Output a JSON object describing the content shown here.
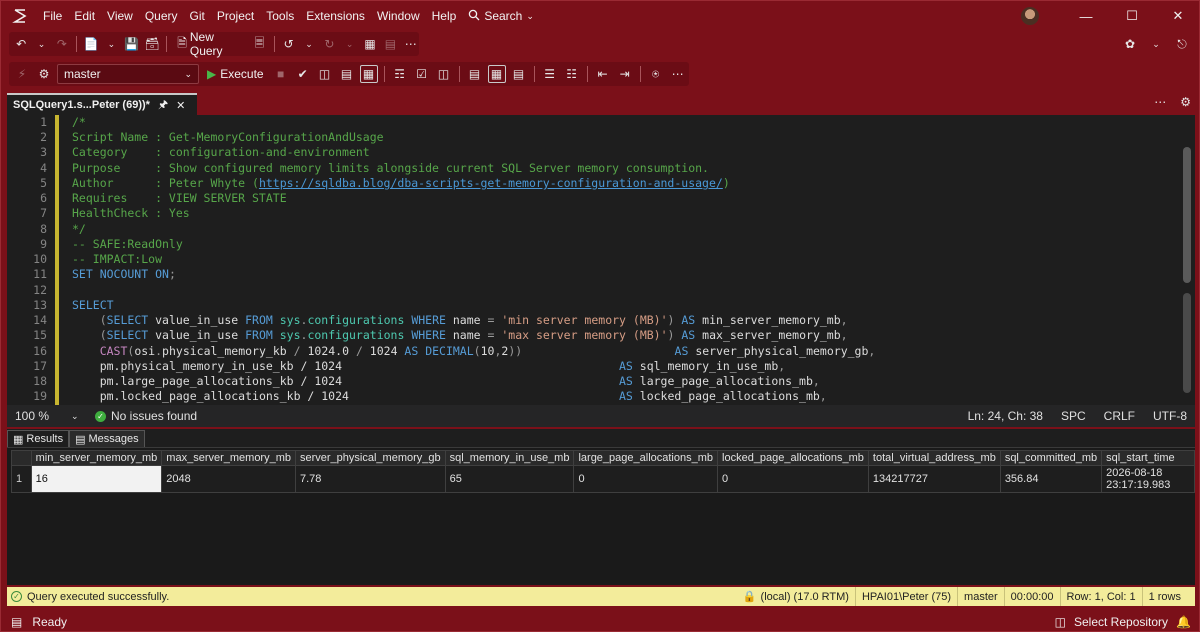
{
  "menu": [
    "File",
    "Edit",
    "View",
    "Query",
    "Git",
    "Project",
    "Tools",
    "Extensions",
    "Window",
    "Help"
  ],
  "search_label": "Search",
  "toolbar": {
    "new_query": "New Query",
    "database": "master",
    "execute": "Execute"
  },
  "tab": {
    "title": "SQLQuery1.s...Peter (69))*"
  },
  "code_lines": [
    "1",
    "2",
    "3",
    "4",
    "5",
    "6",
    "7",
    "8",
    "9",
    "10",
    "11",
    "12",
    "13",
    "14",
    "15",
    "16",
    "17",
    "18",
    "19"
  ],
  "code": {
    "l1": "/*",
    "l2": "Script Name : Get-MemoryConfigurationAndUsage",
    "l3": "Category    : configuration-and-environment",
    "l4": "Purpose     : Show configured memory limits alongside current SQL Server memory consumption.",
    "l5a": "Author      : Peter Whyte (",
    "l5link": "https://sqldba.blog/dba-scripts-get-memory-configuration-and-usage/",
    "l5b": ")",
    "l6": "Requires    : VIEW SERVER STATE",
    "l7": "HealthCheck : Yes",
    "l8": "*/",
    "l9": "-- SAFE:ReadOnly",
    "l10": "-- IMPACT:Low",
    "l11_kw": "SET NOCOUNT ON",
    "l11_end": ";",
    "l13": "SELECT",
    "l14_str": "'min server memory (MB)'",
    "l14_alias": "min_server_memory_mb",
    "l15_str": "'max server memory (MB)'",
    "l15_alias": "max_server_memory_mb",
    "l16_alias": "server_physical_memory_gb",
    "l17_expr": "pm.physical_memory_in_use_kb / 1024",
    "l17_alias": "sql_memory_in_use_mb",
    "l18_expr": "pm.large_page_allocations_kb / 1024",
    "l18_alias": "large_page_allocations_mb",
    "l19_expr": "pm.locked_page_allocations_kb / 1024",
    "l19_alias": "locked_page_allocations_mb"
  },
  "editor_status": {
    "zoom": "100 %",
    "issues": "No issues found",
    "position": "Ln: 24, Ch: 38",
    "whitespace": "SPC",
    "line_ending": "CRLF",
    "encoding": "UTF-8"
  },
  "results_tabs": [
    "Results",
    "Messages"
  ],
  "grid": {
    "columns": [
      "min_server_memory_mb",
      "max_server_memory_mb",
      "server_physical_memory_gb",
      "sql_memory_in_use_mb",
      "large_page_allocations_mb",
      "locked_page_allocations_mb",
      "total_virtual_address_mb",
      "sql_committed_mb",
      "sql_start_time"
    ],
    "rows": [
      [
        "1",
        "16",
        "2048",
        "7.78",
        "65",
        "0",
        "0",
        "134217727",
        "356.84",
        "2026-08-18 23:17:19.983"
      ]
    ]
  },
  "query_status": {
    "message": "Query executed successfully.",
    "server": "(local) (17.0 RTM)",
    "user": "HPAI01\\Peter (75)",
    "database": "master",
    "elapsed": "00:00:00",
    "rowcol": "Row: 1, Col: 1",
    "rows": "1 rows"
  },
  "app_status": {
    "ready": "Ready",
    "repo": "Select Repository"
  },
  "colors": {
    "frame": "#7b1019",
    "editor_bg": "#1e1e1e",
    "status_yellow": "#f3ec9b"
  }
}
